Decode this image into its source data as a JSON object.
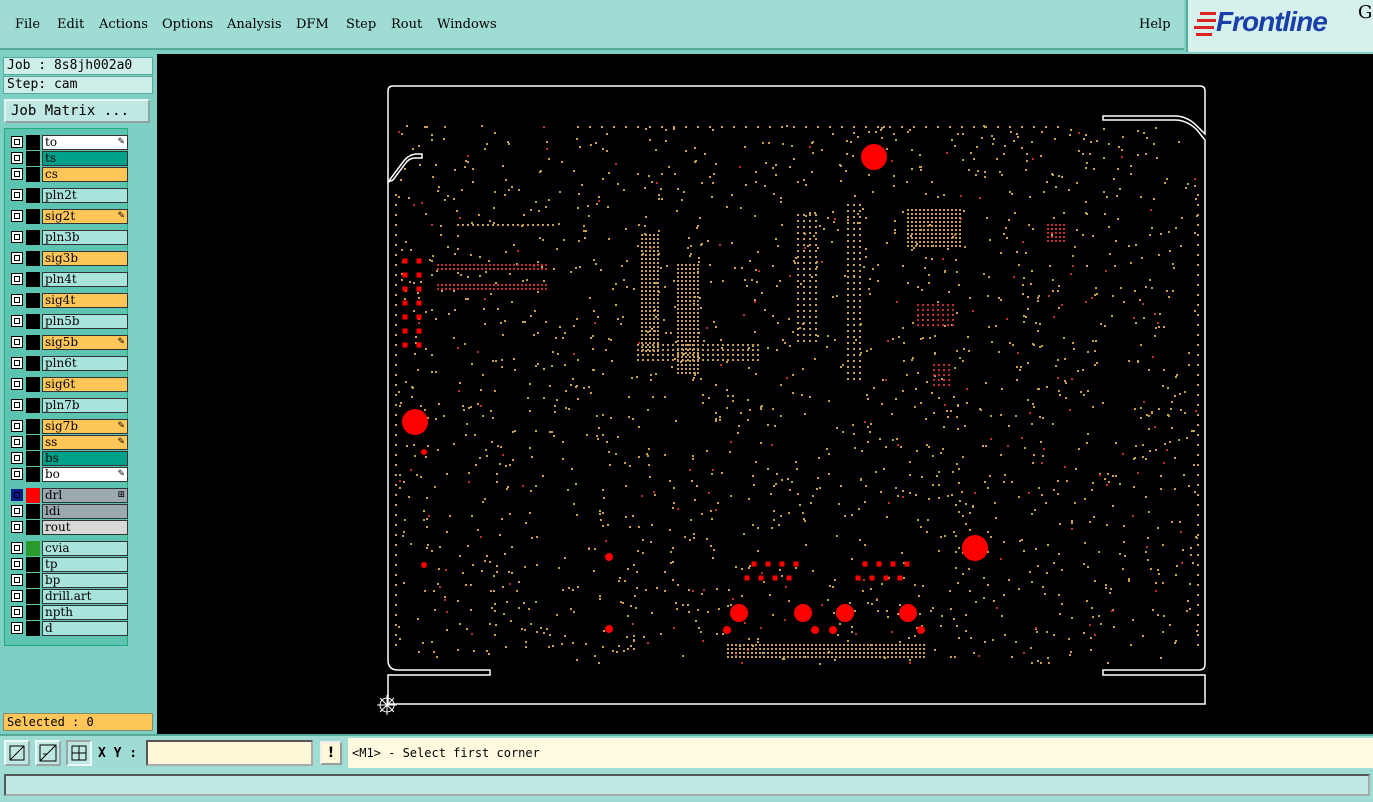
{
  "menubar": {
    "items": [
      "File",
      "Edit",
      "Actions",
      "Options",
      "Analysis",
      "DFM",
      "Step",
      "Rout",
      "Windows"
    ],
    "help": "Help"
  },
  "logo": {
    "text": "Frontline",
    "suffix": "G"
  },
  "job": {
    "job_label": "Job : 8s8jh002a0",
    "step_label": "Step: cam",
    "matrix_button": "Job Matrix ..."
  },
  "layers": [
    {
      "name": "to",
      "color": "#ffffff",
      "mark": "✎"
    },
    {
      "name": "ts",
      "color": "#00a08a",
      "mark": ""
    },
    {
      "name": "cs",
      "color": "#ffc75a",
      "mark": ""
    },
    {
      "name": "pln2t",
      "color": "#a8e4dc",
      "mark": ""
    },
    {
      "name": "sig2t",
      "color": "#ffc75a",
      "mark": "✎"
    },
    {
      "name": "pln3b",
      "color": "#a8e4dc",
      "mark": ""
    },
    {
      "name": "sig3b",
      "color": "#ffc75a",
      "mark": ""
    },
    {
      "name": "pln4t",
      "color": "#a8e4dc",
      "mark": ""
    },
    {
      "name": "sig4t",
      "color": "#ffc75a",
      "mark": ""
    },
    {
      "name": "pln5b",
      "color": "#a8e4dc",
      "mark": ""
    },
    {
      "name": "sig5b",
      "color": "#ffc75a",
      "mark": "✎"
    },
    {
      "name": "pln6t",
      "color": "#a8e4dc",
      "mark": ""
    },
    {
      "name": "sig6t",
      "color": "#ffc75a",
      "mark": ""
    },
    {
      "name": "pln7b",
      "color": "#a8e4dc",
      "mark": ""
    },
    {
      "name": "sig7b",
      "color": "#ffc75a",
      "mark": "✎"
    },
    {
      "name": "ss",
      "color": "#ffc75a",
      "mark": "✎"
    },
    {
      "name": "bs",
      "color": "#00a08a",
      "mark": ""
    },
    {
      "name": "bo",
      "color": "#ffffff",
      "mark": "✎"
    },
    {
      "name": "drl",
      "color": "#9aaab0",
      "mark": "⊞",
      "active": true
    },
    {
      "name": "ldi",
      "color": "#9aaab0",
      "mark": ""
    },
    {
      "name": "rout",
      "color": "#d8d8d8",
      "mark": ""
    },
    {
      "name": "cvia",
      "color": "#a8e4dc",
      "mark": "",
      "swatch": "#2a9a2a"
    },
    {
      "name": "tp",
      "color": "#a8e4dc",
      "mark": ""
    },
    {
      "name": "bp",
      "color": "#a8e4dc",
      "mark": ""
    },
    {
      "name": "drill.art",
      "color": "#a8e4dc",
      "mark": ""
    },
    {
      "name": "npth",
      "color": "#a8e4dc",
      "mark": ""
    },
    {
      "name": "d",
      "color": "#a8e4dc",
      "mark": ""
    }
  ],
  "selected": "Selected : 0",
  "bottom": {
    "xy_label": "X Y :",
    "xy_value": "",
    "excl": "!",
    "prompt": "<M1> - Select first corner"
  },
  "colors": {
    "drill": "#ff0000",
    "pad": "#c8a050",
    "outline": "#ffffff"
  }
}
